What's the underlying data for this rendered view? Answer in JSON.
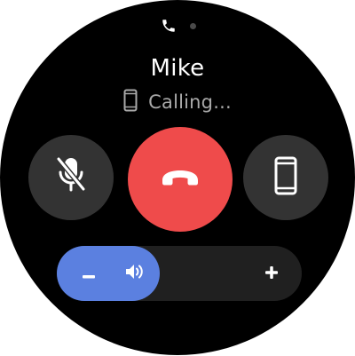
{
  "caller": {
    "name": "Mike",
    "status": "Calling..."
  },
  "indicators": {
    "page_icon": "phone-icon",
    "page_count": 2,
    "active_page": 1
  },
  "controls": {
    "mute": {
      "icon": "mic-off-icon",
      "state": "muted"
    },
    "end_call": {
      "icon": "hang-up-icon",
      "color": "#ef4b4b"
    },
    "audio_device": {
      "icon": "smartphone-icon"
    }
  },
  "volume": {
    "level": 0.42,
    "minus_icon": "minus-icon",
    "speaker_icon": "speaker-icon",
    "plus_icon": "plus-icon",
    "accent_color": "#5b80e0"
  },
  "colors": {
    "background": "#000000",
    "button_gray": "#333333",
    "status_text": "#a9a9a9"
  }
}
